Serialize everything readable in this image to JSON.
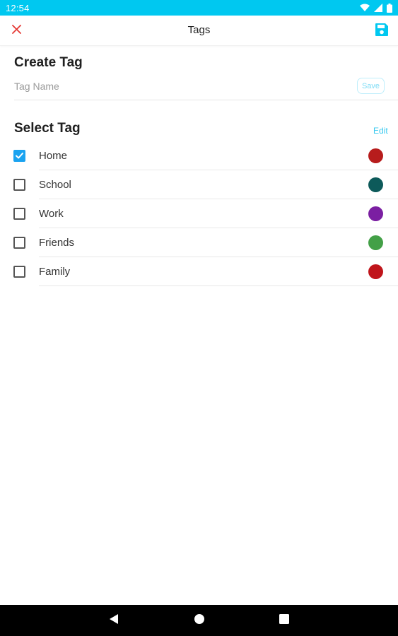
{
  "status_bar": {
    "time": "12:54"
  },
  "app_bar": {
    "title": "Tags"
  },
  "create_tag": {
    "title": "Create Tag",
    "input_placeholder": "Tag Name",
    "input_value": "",
    "save_label": "Save"
  },
  "select_tag": {
    "title": "Select Tag",
    "edit_label": "Edit",
    "tags": [
      {
        "label": "Home",
        "checked": true,
        "color": "#b71c1c"
      },
      {
        "label": "School",
        "checked": false,
        "color": "#0d5a5a"
      },
      {
        "label": "Work",
        "checked": false,
        "color": "#7b1fa2"
      },
      {
        "label": "Friends",
        "checked": false,
        "color": "#43a047"
      },
      {
        "label": "Family",
        "checked": false,
        "color": "#c0151b"
      }
    ]
  },
  "colors": {
    "accent": "#00c8f0",
    "close_icon": "#e53935",
    "checkbox_checked": "#1aa3f0"
  }
}
